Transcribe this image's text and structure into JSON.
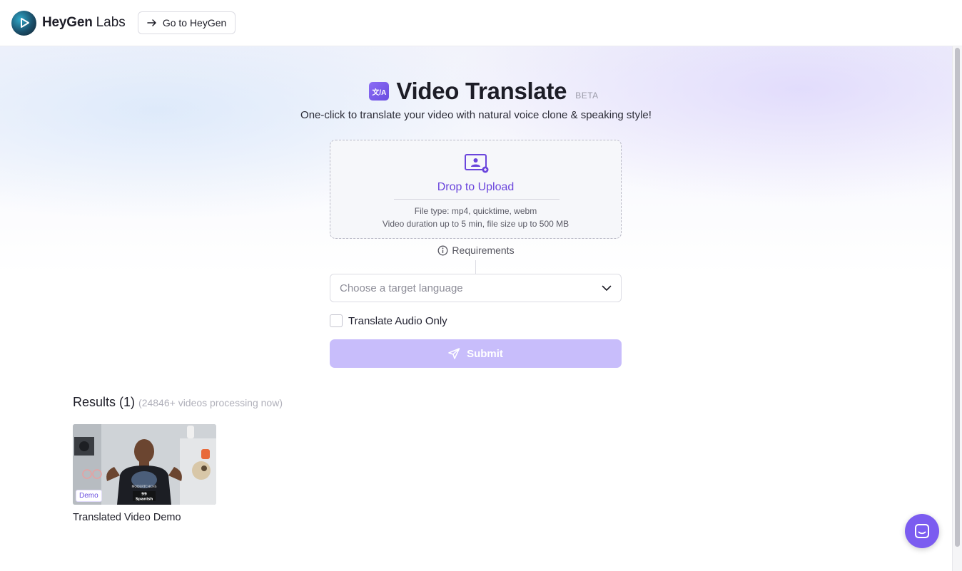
{
  "header": {
    "brand": "HeyGen",
    "brand_sub": "Labs",
    "go_button": "Go to HeyGen"
  },
  "hero": {
    "title": "Video Translate",
    "title_icon_text": "文/A",
    "badge": "BETA",
    "subtitle": "One-click to translate your video with natural voice clone & speaking style!"
  },
  "upload": {
    "label": "Drop to Upload",
    "file_types": "File type: mp4, quicktime, webm",
    "limits": "Video duration up to 5 min, file size up to 500 MB",
    "requirements": "Requirements"
  },
  "form": {
    "language_placeholder": "Choose a target language",
    "audio_only_label": "Translate Audio Only",
    "audio_only_checked": false,
    "submit_label": "Submit"
  },
  "results": {
    "title": "Results (1)",
    "processing": "(24846+ videos processing now)",
    "items": [
      {
        "title": "Translated Video Demo",
        "badge": "Demo",
        "caption_number": "99",
        "caption_language": "Spanish",
        "shirt_text": "MODERTCHCHS"
      }
    ]
  },
  "colors": {
    "accent": "#6a45dc",
    "submit_disabled": "#c8bdfb",
    "chat_button": "#7b5cf0"
  },
  "icons": [
    "arrow-right-icon",
    "translate-icon",
    "upload-user-icon",
    "info-icon",
    "chevron-down-icon",
    "send-icon",
    "chat-icon"
  ]
}
